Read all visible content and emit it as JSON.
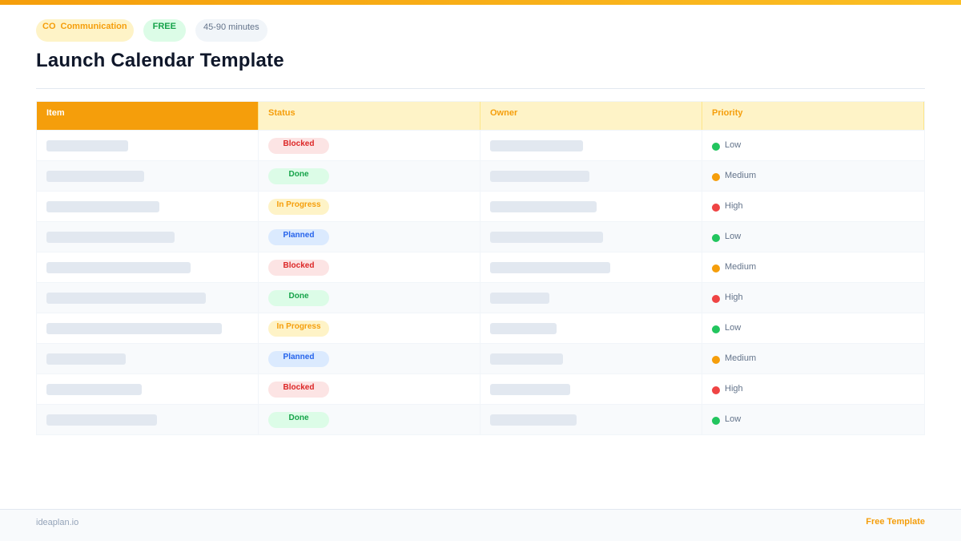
{
  "header": {
    "tags": {
      "category_code": "CO",
      "category": "Communication",
      "price": "FREE",
      "duration": "45-90 minutes"
    },
    "title": "Launch Calendar Template"
  },
  "table": {
    "columns": [
      "Item",
      "Status",
      "Owner",
      "Priority"
    ],
    "rows": [
      {
        "status": "Blocked",
        "priority": "Low"
      },
      {
        "status": "Done",
        "priority": "Medium"
      },
      {
        "status": "In Progress",
        "priority": "High"
      },
      {
        "status": "Planned",
        "priority": "Low"
      },
      {
        "status": "Blocked",
        "priority": "Medium"
      },
      {
        "status": "Done",
        "priority": "High"
      },
      {
        "status": "In Progress",
        "priority": "Low"
      },
      {
        "status": "Planned",
        "priority": "Medium"
      },
      {
        "status": "Blocked",
        "priority": "High"
      },
      {
        "status": "Done",
        "priority": "Low"
      }
    ]
  },
  "colors": {
    "accent": "#f59e0b",
    "priority_low": "#22c55e",
    "priority_medium": "#f59e0b",
    "priority_high": "#ef4444"
  },
  "footer": {
    "site": "ideaplan.io",
    "label": "Free Template"
  }
}
